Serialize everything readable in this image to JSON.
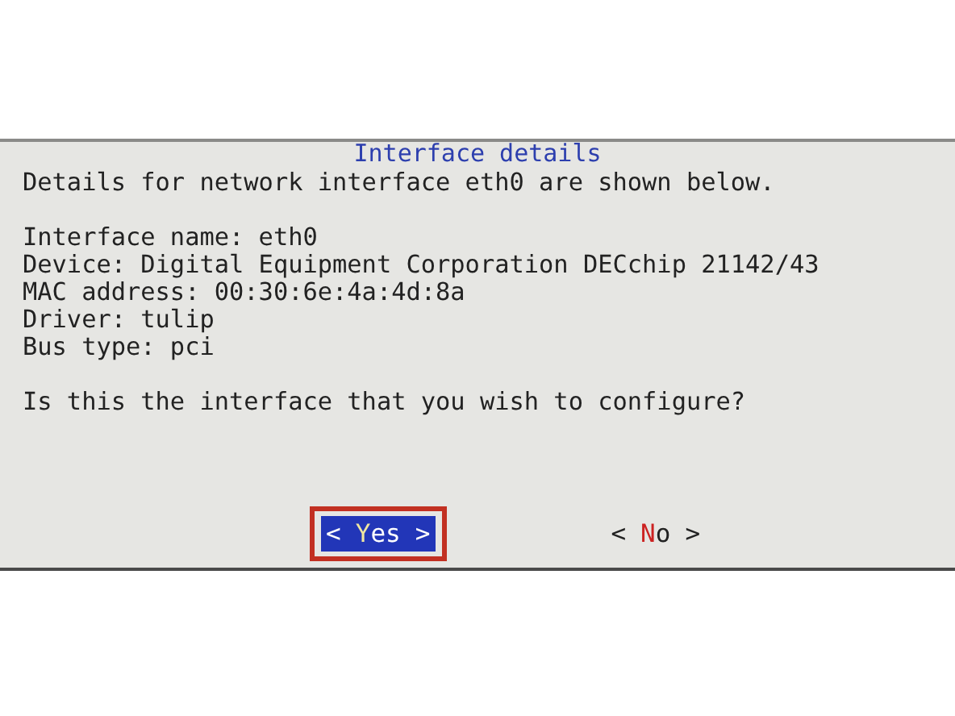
{
  "dialog": {
    "title": "Interface details",
    "paragraphs": [
      [
        "Details for network interface eth0 are shown below."
      ],
      [
        "Interface name: eth0",
        "Device: Digital Equipment Corporation DECchip 21142/43",
        "MAC address: 00:30:6e:4a:4d:8a",
        "Driver: tulip",
        "Bus type: pci"
      ],
      [
        "Is this the interface that you wish to configure?"
      ]
    ],
    "buttons": [
      {
        "open": "<",
        "hotkey": "Y",
        "rest": "es",
        "close": ">",
        "selected": true,
        "annotated": true
      },
      {
        "open": "<",
        "hotkey": "N",
        "rest": "o",
        "close": ">",
        "selected": false,
        "annotated": false
      }
    ]
  }
}
